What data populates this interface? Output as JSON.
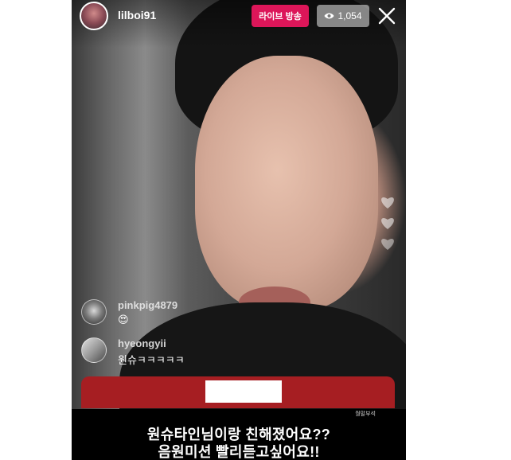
{
  "header": {
    "username": "lilboi91",
    "live_label": "라이브 방송",
    "viewer_count": "1,054"
  },
  "comments": [
    {
      "username": "pinkpig4879",
      "text": "😍"
    },
    {
      "username": "hyeongyii",
      "text": "원슈ㅋㅋㅋㅋㅋ"
    }
  ],
  "watermark": "월말부석",
  "caption": {
    "line1": "원슈타인님이랑 친해졌어요??",
    "line2": "음원미션 빨리듣고싶어요!!"
  },
  "colors": {
    "live_badge": "#dc1659",
    "question_card": "#a61e22"
  },
  "icons": {
    "viewer": "eye-icon",
    "close": "close-icon",
    "hearts": "heart-icon"
  }
}
